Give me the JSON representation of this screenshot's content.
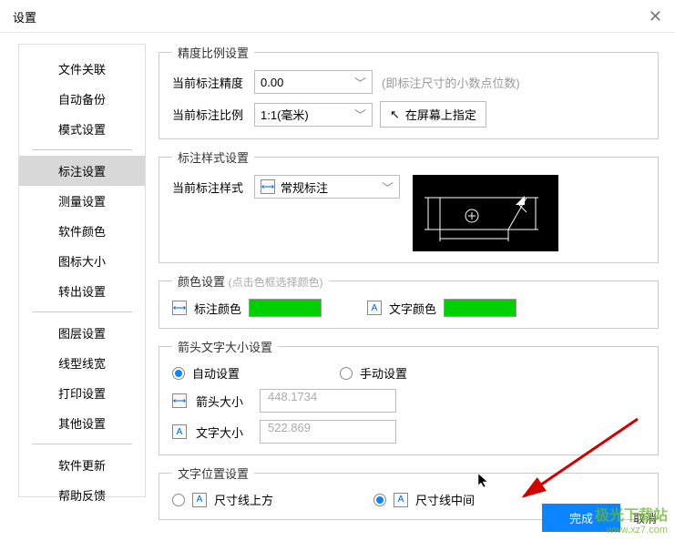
{
  "title": "设置",
  "sidebar": {
    "group1": [
      "文件关联",
      "自动备份",
      "模式设置"
    ],
    "group2": [
      "标注设置",
      "测量设置",
      "软件颜色",
      "图标大小",
      "转出设置"
    ],
    "group3": [
      "图层设置",
      "线型线宽",
      "打印设置",
      "其他设置"
    ],
    "group4": [
      "软件更新",
      "帮助反馈"
    ]
  },
  "precision": {
    "legend": "精度比例设置",
    "precision_label": "当前标注精度",
    "precision_value": "0.00",
    "precision_hint": "(即标注尺寸的小数点位数)",
    "scale_label": "当前标注比例",
    "scale_value": "1:1(毫米)",
    "screen_btn": "在屏幕上指定"
  },
  "dim_style": {
    "legend": "标注样式设置",
    "label": "当前标注样式",
    "value": "常规标注"
  },
  "color": {
    "legend": "颜色设置",
    "hint": "(点击色框选择颜色)",
    "dim_label": "标注颜色",
    "text_label": "文字颜色",
    "swatch_hex": "#00d000"
  },
  "arrow_text": {
    "legend": "箭头文字大小设置",
    "auto": "自动设置",
    "manual": "手动设置",
    "arrow_label": "箭头大小",
    "arrow_value": "448.1734",
    "text_label": "文字大小",
    "text_value": "522.869"
  },
  "text_pos": {
    "legend": "文字位置设置",
    "above": "尺寸线上方",
    "middle": "尺寸线中间"
  },
  "footer": {
    "ok": "完成",
    "cancel": "取消"
  },
  "watermark": {
    "line1": "极光下载站",
    "line2": "www.xz7.com"
  }
}
